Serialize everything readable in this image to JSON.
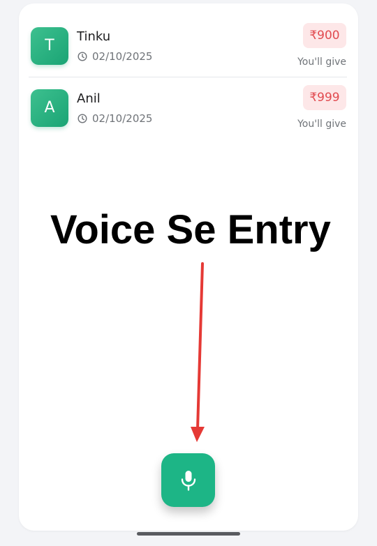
{
  "entries": [
    {
      "avatar_letter": "T",
      "name": "Tinku",
      "date": "02/10/2025",
      "amount": "₹900",
      "status": "You'll give"
    },
    {
      "avatar_letter": "A",
      "name": "Anil",
      "date": "02/10/2025",
      "amount": "₹999",
      "status": "You'll give"
    }
  ],
  "overlay": {
    "title": "Voice Se Entry"
  },
  "fab": {
    "icon": "microphone-icon"
  },
  "colors": {
    "brand_green": "#1db586",
    "amount_red": "#e14a4f",
    "amount_bg": "#fde7e8",
    "arrow_red": "#e53935"
  }
}
